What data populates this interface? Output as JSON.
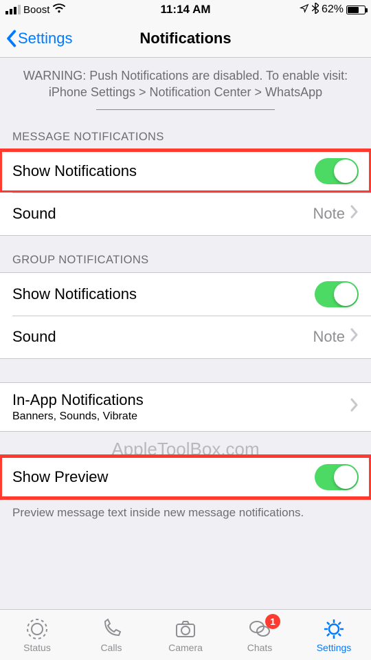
{
  "status_bar": {
    "carrier": "Boost",
    "time": "11:14 AM",
    "battery_pct": "62%"
  },
  "nav": {
    "back_label": "Settings",
    "title": "Notifications"
  },
  "warning": {
    "line1": "WARNING: Push Notifications are disabled. To enable visit:",
    "line2": "iPhone Settings > Notification Center > WhatsApp"
  },
  "sections": {
    "message_notifications": {
      "header": "MESSAGE NOTIFICATIONS",
      "show_notifications": "Show Notifications",
      "sound_label": "Sound",
      "sound_value": "Note"
    },
    "group_notifications": {
      "header": "GROUP NOTIFICATIONS",
      "show_notifications": "Show Notifications",
      "sound_label": "Sound",
      "sound_value": "Note"
    },
    "in_app": {
      "label": "In-App Notifications",
      "detail": "Banners, Sounds, Vibrate"
    },
    "show_preview": {
      "label": "Show Preview",
      "footer": "Preview message text inside new message notifications."
    }
  },
  "watermark": "AppleToolBox.com",
  "tabs": {
    "status": "Status",
    "calls": "Calls",
    "camera": "Camera",
    "chats": "Chats",
    "chats_badge": "1",
    "settings": "Settings"
  }
}
